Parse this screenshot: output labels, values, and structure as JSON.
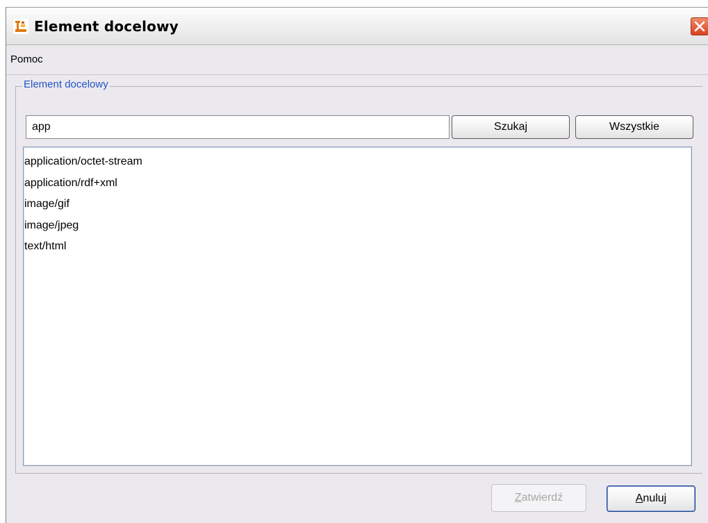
{
  "window": {
    "title": "Element docelowy",
    "app_icon": "app-logo-icon",
    "close_icon": "close-icon"
  },
  "menubar": {
    "items": [
      {
        "label": "Pomoc"
      }
    ]
  },
  "group": {
    "title": "Element docelowy"
  },
  "search": {
    "value": "app",
    "search_button": "Szukaj",
    "all_button": "Wszystkie"
  },
  "list": {
    "items": [
      "application/octet-stream",
      "application/rdf+xml",
      "image/gif",
      "image/jpeg",
      "text/html"
    ]
  },
  "footer": {
    "confirm_label": "Zatwierdź",
    "confirm_mnemonic": "Z",
    "confirm_rest": "atwierdź",
    "confirm_enabled": false,
    "cancel_label": "Anuluj",
    "cancel_mnemonic": "A",
    "cancel_rest": "nuluj"
  },
  "colors": {
    "group_title": "#2454c8",
    "close_button": "#d9441f",
    "window_bg": "#ebe9ed"
  }
}
